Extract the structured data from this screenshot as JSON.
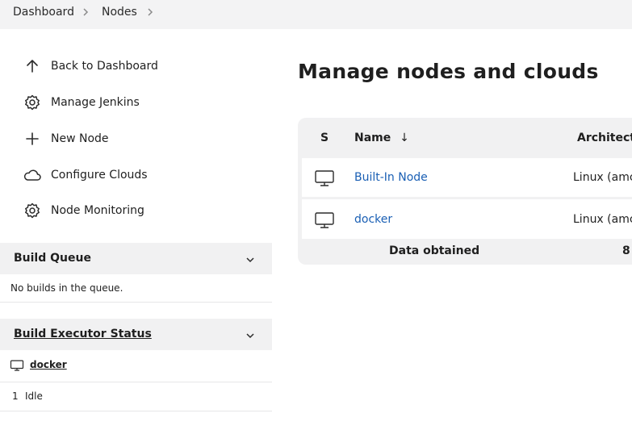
{
  "breadcrumb": {
    "items": [
      "Dashboard",
      "Nodes"
    ]
  },
  "sidebar": {
    "links": [
      {
        "label": "Back to Dashboard",
        "icon": "arrow-up-icon"
      },
      {
        "label": "Manage Jenkins",
        "icon": "gear-icon"
      },
      {
        "label": "New Node",
        "icon": "plus-icon"
      },
      {
        "label": "Configure Clouds",
        "icon": "cloud-icon"
      },
      {
        "label": "Node Monitoring",
        "icon": "gear-icon"
      }
    ]
  },
  "build_queue": {
    "title": "Build Queue",
    "empty_text": "No builds in the queue."
  },
  "executor_status": {
    "title": "Build Executor Status",
    "node": "docker",
    "executors": [
      {
        "number": "1",
        "status": "Idle"
      }
    ]
  },
  "main": {
    "title": "Manage nodes and clouds",
    "table": {
      "headers": {
        "status": "S",
        "name": "Name",
        "sort_arrow": "↓",
        "architecture": "Architect"
      },
      "rows": [
        {
          "name": "Built-In Node",
          "architecture": "Linux (amc"
        },
        {
          "name": "docker",
          "architecture": "Linux (amc"
        }
      ],
      "footer": {
        "label": "Data obtained",
        "value": "8"
      }
    }
  },
  "colors": {
    "link": "#1a5fb4",
    "pane_bg": "#f1f1f2",
    "breadcrumb_bg": "#f3f3f4"
  }
}
